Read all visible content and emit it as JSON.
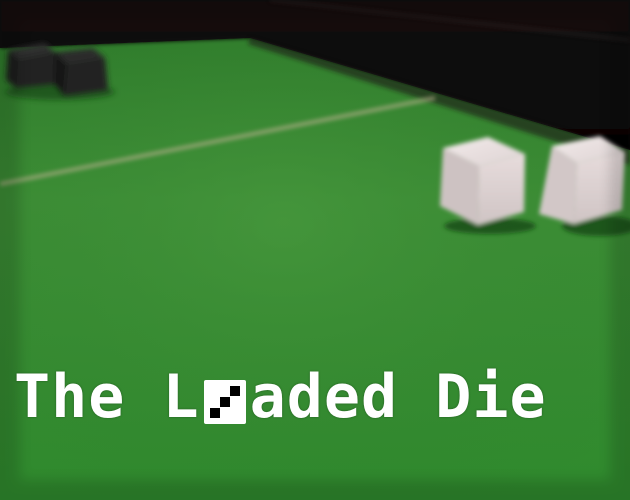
{
  "game": {
    "title_before": "The L",
    "title_die_icon": "die-face-three-icon",
    "title_after": "aded Die"
  },
  "colors": {
    "felt": "#3d8f35",
    "felt_dark": "#2d7a2a",
    "rail": "#0d0b0b",
    "die_white": "#e9e0e0",
    "die_black": "#1c1c1c",
    "title_text": "#ffffff"
  }
}
